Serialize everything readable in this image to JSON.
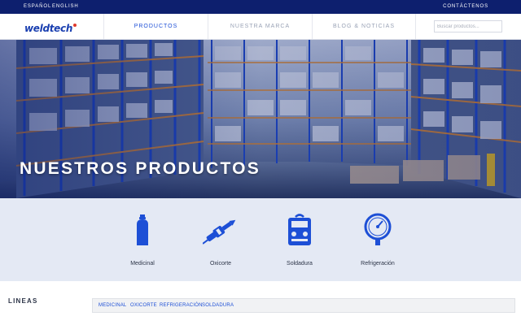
{
  "topbar": {
    "languages": [
      "ESPAÑOL",
      "ENGLISH"
    ],
    "contact_label": "CONTÁCTENOS",
    "background": "#0d1f6e"
  },
  "header": {
    "logo_text": "weldtech",
    "nav": [
      {
        "label": "PRODUCTOS",
        "active": true
      },
      {
        "label": "NUESTRA MARCA",
        "active": false
      },
      {
        "label": "BLOG & NOTICIAS",
        "active": false
      }
    ],
    "search": {
      "placeholder": "Buscar productos...",
      "value": ""
    }
  },
  "hero": {
    "title": "NUESTROS PRODUCTOS"
  },
  "categories": {
    "accent": "#1d4fd6",
    "items": [
      {
        "label": "Medicinal",
        "icon": "gas-cylinder-icon"
      },
      {
        "label": "Oxicorte",
        "icon": "cutting-torch-icon"
      },
      {
        "label": "Soldadura",
        "icon": "welding-machine-icon"
      },
      {
        "label": "Refrigeración",
        "icon": "pressure-gauge-icon"
      }
    ]
  },
  "lines": {
    "title": "LINEAS",
    "filters": [
      "MEDICINAL",
      "OXICORTE",
      "REFRIGERACIÓN",
      "SOLDADURA"
    ]
  }
}
